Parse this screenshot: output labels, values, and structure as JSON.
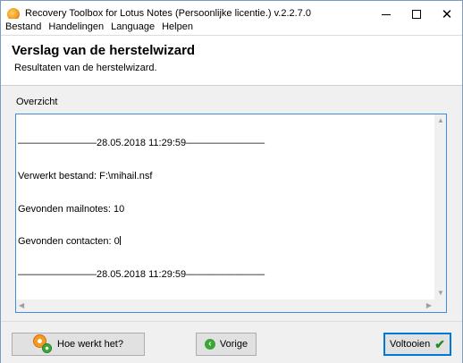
{
  "window": {
    "title": "Recovery Toolbox for Lotus Notes (Persoonlijke licentie.) v.2.2.7.0"
  },
  "menu": [
    {
      "label": "Bestand"
    },
    {
      "label": "Handelingen"
    },
    {
      "label": "Language"
    },
    {
      "label": "Helpen"
    }
  ],
  "header": {
    "title": "Verslag van de herstelwizard",
    "subtitle": "Resultaten van de herstelwizard."
  },
  "overview": {
    "label": "Overzicht",
    "lines": [
      "————————28.05.2018 11:29:59————————",
      "Verwerkt bestand: F:\\mihail.nsf",
      "Gevonden mailnotes: 10",
      "Gevonden contacten: 0",
      "————————28.05.2018 11:29:59————————"
    ]
  },
  "buttons": {
    "help": "Hoe werkt het?",
    "back": "Vorige",
    "finish": "Voltooien"
  }
}
